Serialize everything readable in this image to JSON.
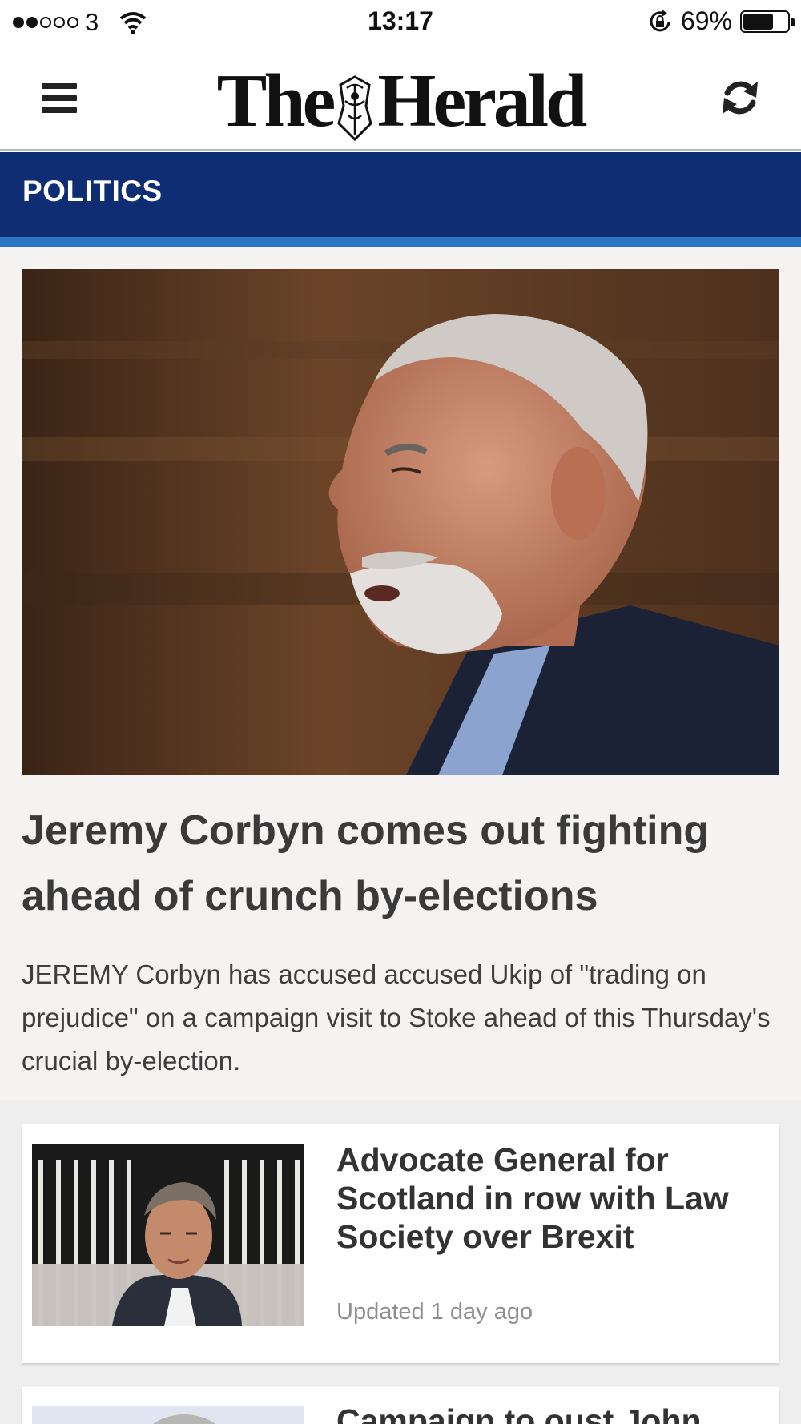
{
  "status_bar": {
    "carrier": "3",
    "time": "13:17",
    "battery_text": "69%",
    "battery_level": 0.69
  },
  "header": {
    "logo_text_left": "The",
    "logo_text_right": "Herald",
    "menu_icon": "hamburger-icon",
    "refresh_icon": "refresh-icon"
  },
  "section": {
    "title": "POLITICS"
  },
  "lead_story": {
    "headline": "Jeremy Corbyn comes out fighting ahead of crunch by-elections",
    "summary": "JEREMY Corbyn has accused accused Ukip of \"trading on prejudice\" on a campaign visit to Stoke ahead of this Thursday's crucial by-election."
  },
  "stories": [
    {
      "headline": "Advocate General for Scotland in row with Law Society over Brexit",
      "meta": "Updated 1 day ago"
    },
    {
      "headline": "Campaign to oust John",
      "meta": ""
    }
  ],
  "colors": {
    "section_bar": "#0e2d73",
    "section_stripe": "#2a78c4",
    "lead_background": "#f5f3f1",
    "list_background": "#eeeeef"
  }
}
